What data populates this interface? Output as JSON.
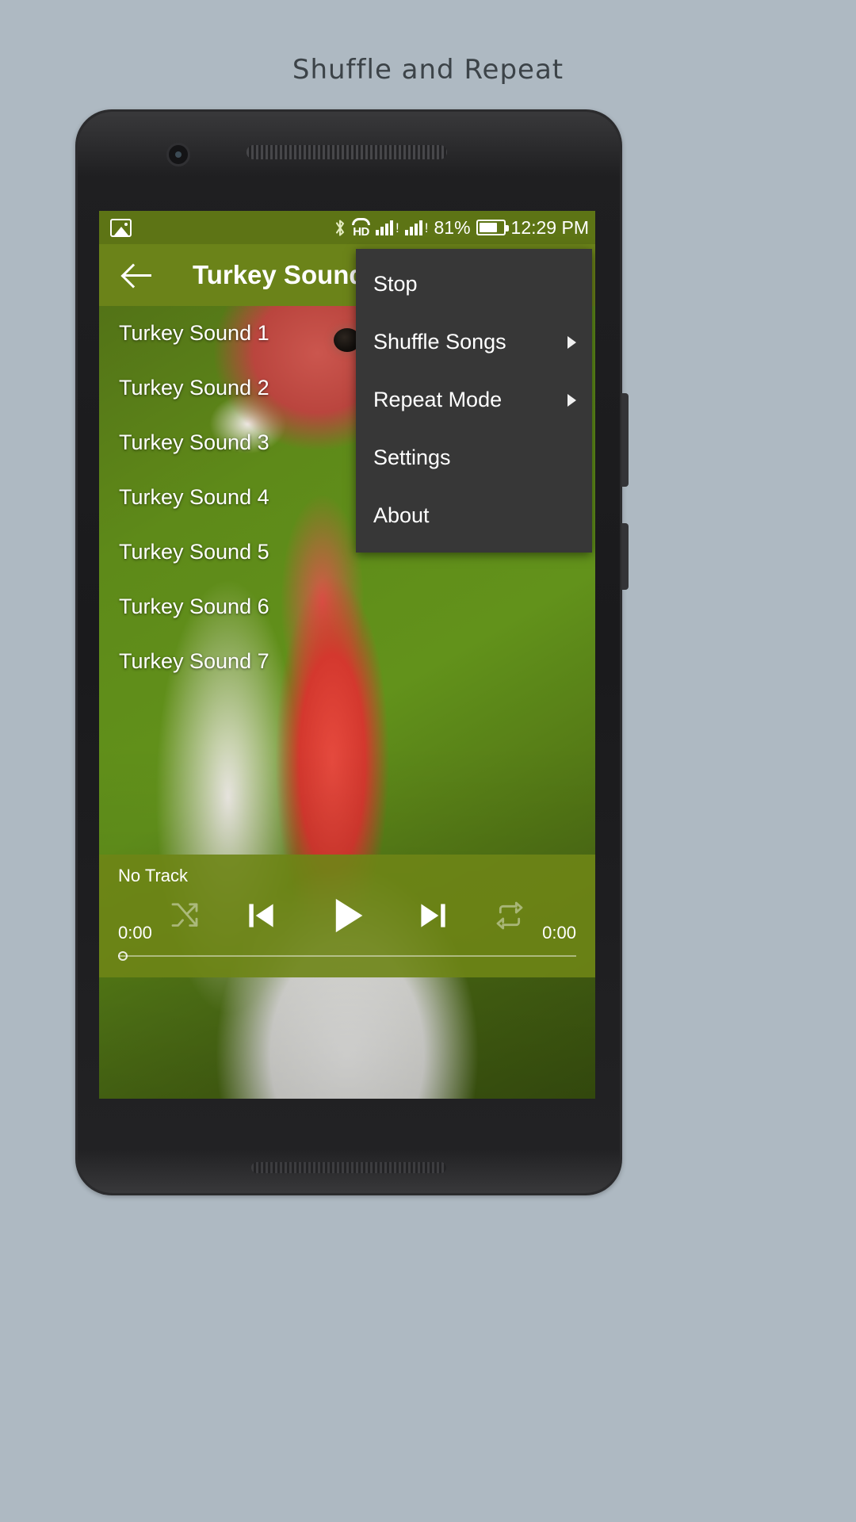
{
  "page": {
    "caption": "Shuffle and Repeat",
    "background_color": "#aeb9c2",
    "caption_color": "#3c4348"
  },
  "theme": {
    "status_bar_color": "#5d7415",
    "toolbar_color": "#6b8319",
    "menu_color": "#373737",
    "player_bar_color": "#6e8516",
    "text_on_dark": "#ffffff"
  },
  "status_bar": {
    "left_icon": "photo-icon",
    "bluetooth_icon": "bluetooth-icon",
    "hd_label": "HD",
    "signal_1_icon": "signal-bars-icon",
    "signal_2_icon": "signal-bars-icon",
    "battery_percent": "81%",
    "battery_icon": "battery-icon",
    "battery_level": 78,
    "time": "12:29 PM"
  },
  "toolbar": {
    "back_icon": "back-arrow-icon",
    "title": "Turkey Sounds"
  },
  "track_list": {
    "items": [
      {
        "label": "Turkey Sound 1"
      },
      {
        "label": "Turkey Sound 2"
      },
      {
        "label": "Turkey Sound 3"
      },
      {
        "label": "Turkey Sound 4"
      },
      {
        "label": "Turkey Sound 5"
      },
      {
        "label": "Turkey Sound 6"
      },
      {
        "label": "Turkey Sound 7"
      }
    ]
  },
  "overflow_menu": {
    "items": [
      {
        "label": "Stop",
        "has_submenu": false
      },
      {
        "label": "Shuffle Songs",
        "has_submenu": true
      },
      {
        "label": "Repeat Mode",
        "has_submenu": true
      },
      {
        "label": "Settings",
        "has_submenu": false
      },
      {
        "label": "About",
        "has_submenu": false
      }
    ]
  },
  "player": {
    "track_title": "No Track",
    "elapsed_time": "0:00",
    "total_time": "0:00",
    "progress_percent": 0,
    "shuffle_icon": "shuffle-icon",
    "previous_icon": "skip-previous-icon",
    "play_icon": "play-icon",
    "next_icon": "skip-next-icon",
    "repeat_icon": "repeat-icon",
    "shuffle_enabled": false,
    "repeat_enabled": false
  }
}
